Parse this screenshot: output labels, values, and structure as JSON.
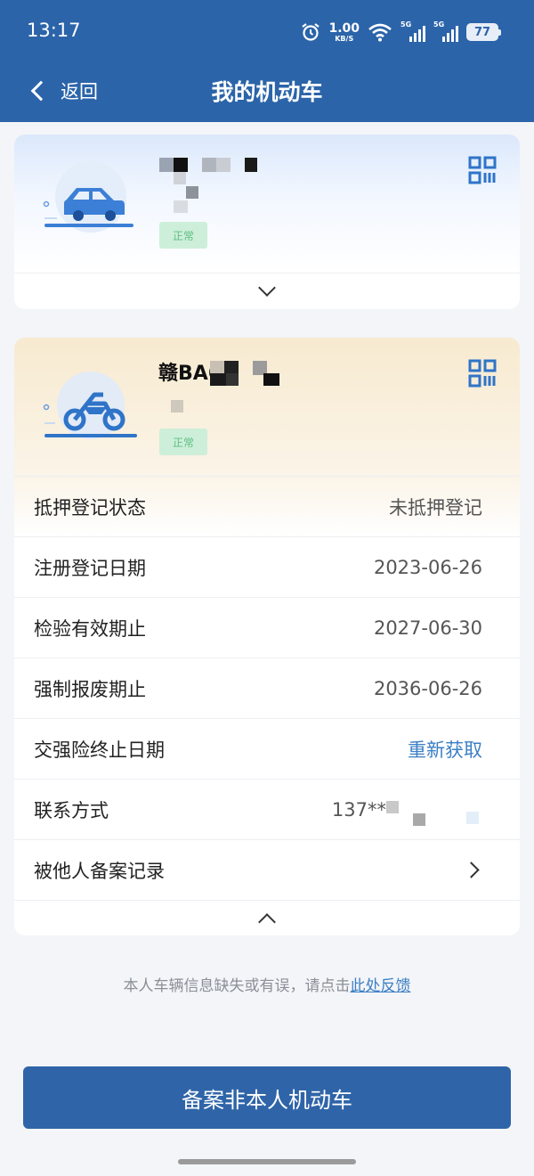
{
  "status_bar": {
    "time": "13:17",
    "net_speed": "1.00",
    "net_speed_unit": "KB/S",
    "signal_tag_1": "5G",
    "signal_tag_2": "5G",
    "battery": "77"
  },
  "nav": {
    "back_label": "返回",
    "title": "我的机动车"
  },
  "vehicles": [
    {
      "type_icon": "car-icon",
      "plate": "",
      "status_chip": "正常",
      "qr_icon": "qr-code-icon",
      "expanded": false
    },
    {
      "type_icon": "motorcycle-icon",
      "plate": "赣BA6",
      "status_chip": "正常",
      "qr_icon": "qr-code-icon",
      "expanded": true,
      "details": [
        {
          "label": "抵押登记状态",
          "value": "未抵押登记"
        },
        {
          "label": "注册登记日期",
          "value": "2023-06-26"
        },
        {
          "label": "检验有效期止",
          "value": "2027-06-30"
        },
        {
          "label": "强制报废期止",
          "value": "2036-06-26"
        },
        {
          "label": "交强险终止日期",
          "value": "重新获取"
        },
        {
          "label": "联系方式",
          "value": "137**"
        },
        {
          "label": "被他人备案记录",
          "value": ""
        }
      ]
    }
  ],
  "feedback": {
    "text": "本人车辆信息缺失或有误，请点击",
    "link": "此处反馈"
  },
  "primary_button": "备案非本人机动车",
  "colors": {
    "header_bg": "#2b64a9",
    "accent_link": "#3b7fc4",
    "button_bg": "#2f65a8"
  }
}
